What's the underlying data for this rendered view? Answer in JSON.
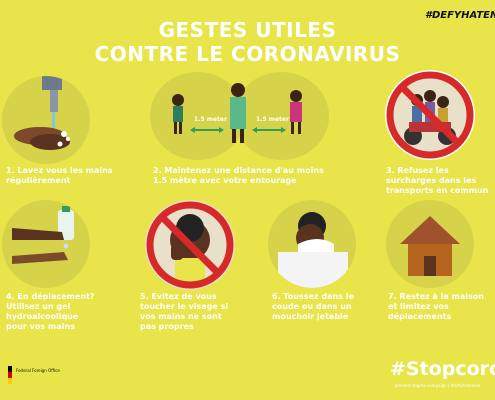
{
  "header": {
    "title_line1": "GESTES UTILES",
    "title_line2": "CONTRE LE CORONAVIRUS",
    "hashtag": "#DEFYHATENOW"
  },
  "steps": [
    {
      "caption": "1. Lavez vous les mains régulièrement",
      "icon": "handwashing-icon"
    },
    {
      "caption": "2. Maintenez une distance d'au moins 1.5 mètre avec votre entourage",
      "icon": "distance-icon",
      "distance_label_left": "1.5 meter",
      "distance_label_right": "1.5 meter"
    },
    {
      "caption": "3. Refusez les surcharges dans les transports en commun",
      "icon": "overloaded-motorbike-icon"
    },
    {
      "caption": "4. En déplacement? Utilisez un gel hydroalcoolique pour vos mains",
      "icon": "hand-sanitizer-icon"
    },
    {
      "caption": "5. Evitez de vous toucher le visage si vos mains ne sont pas propres",
      "icon": "no-face-touch-icon"
    },
    {
      "caption": "6. Toussez dans le coude ou dans un mouchoir jetable",
      "icon": "cough-elbow-icon"
    },
    {
      "caption": "7. Restez à la maison et limitez vos déplacements",
      "icon": "house-icon"
    }
  ],
  "footer": {
    "hashtag": "#Stopcorona",
    "small_text": "prevent-stigma-campaign | #defyhatenow",
    "logo_text": "Federal Foreign Office"
  },
  "colors": {
    "background": "#e8e44a",
    "circle": "#d6d24a",
    "text": "#ffffff",
    "forbid": "#d62a2a"
  }
}
